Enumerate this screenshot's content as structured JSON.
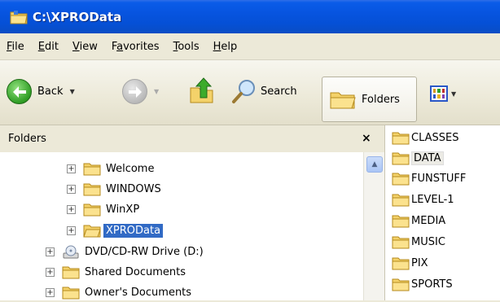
{
  "window": {
    "title": "C:\\XPROData"
  },
  "menu": [
    {
      "pre": "",
      "ul": "F",
      "post": "ile"
    },
    {
      "pre": "",
      "ul": "E",
      "post": "dit"
    },
    {
      "pre": "",
      "ul": "V",
      "post": "iew"
    },
    {
      "pre": "F",
      "ul": "a",
      "post": "vorites"
    },
    {
      "pre": "",
      "ul": "T",
      "post": "ools"
    },
    {
      "pre": "",
      "ul": "H",
      "post": "elp"
    }
  ],
  "toolbar": {
    "back_label": "Back",
    "search_label": "Search",
    "folders_label": "Folders"
  },
  "folder_pane": {
    "header": "Folders",
    "close_glyph": "×",
    "items": [
      {
        "label": "Welcome",
        "expander": "+"
      },
      {
        "label": "WINDOWS",
        "expander": "+"
      },
      {
        "label": "WinXP",
        "expander": "+"
      },
      {
        "label": "XPROData",
        "expander": "+",
        "selected": true
      },
      {
        "label": "DVD/CD-RW Drive (D:)",
        "expander": "+",
        "icon": "dvd-drive-icon"
      },
      {
        "label": "Shared Documents",
        "expander": "+"
      },
      {
        "label": "Owner's Documents",
        "expander": "+"
      }
    ]
  },
  "content": {
    "folders": [
      "CLASSES",
      "DATA",
      "FUNSTUFF",
      "LEVEL-1",
      "MEDIA",
      "MUSIC",
      "PIX",
      "SPORTS"
    ]
  }
}
